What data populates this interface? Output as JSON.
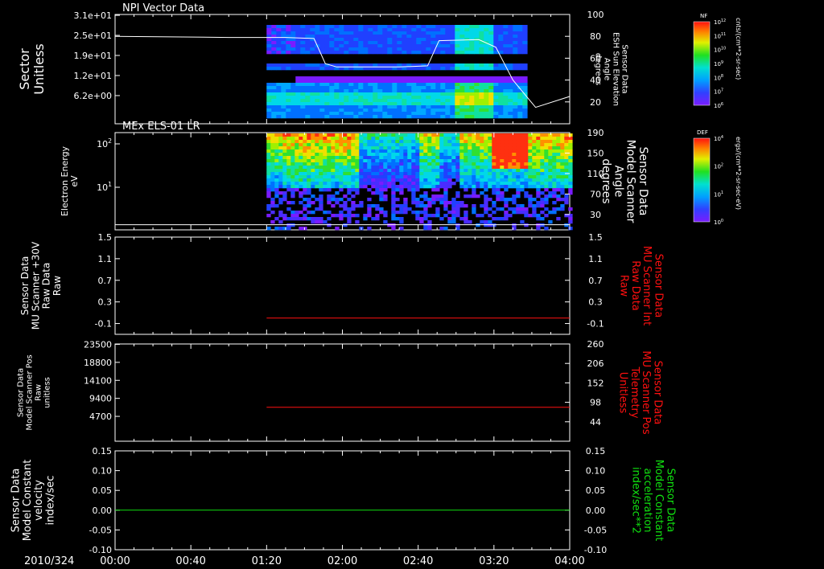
{
  "date_label": "2010/324",
  "time_ticks": [
    "00:00",
    "00:40",
    "01:20",
    "02:00",
    "02:40",
    "03:20",
    "04:00"
  ],
  "colors": {
    "white": "#ffffff",
    "red": "#ff1010",
    "green": "#10e010",
    "black": "#000000"
  },
  "colorbars": [
    {
      "id": "nf",
      "tag": "NF",
      "unit": "cnts/(cm**2-sr-sec)",
      "ticks": [
        "10^12",
        "10^11",
        "10^10",
        "10^9",
        "10^8",
        "10^7",
        "10^6"
      ]
    },
    {
      "id": "def",
      "tag": "DEF",
      "unit": "ergs/(cm**2-sr-sec-eV)",
      "ticks": [
        "10^4",
        "10^2",
        "10^1",
        "10^0"
      ]
    }
  ],
  "panels": [
    {
      "id": "p1",
      "title": "NPI Vector Data",
      "left_label": [
        "Sector",
        "Unitless"
      ],
      "left_color": "#ffffff",
      "left_ticks": [
        "3.1e+01",
        "2.5e+01",
        "1.9e+01",
        "1.2e+01",
        "6.2e+00"
      ],
      "right_label": [
        "Sensor Data",
        "ESH Sun Elevation",
        "Angle",
        "degrees"
      ],
      "right_color": "#ffffff",
      "right_ticks": [
        "100",
        "80",
        "60",
        "40",
        "20"
      ]
    },
    {
      "id": "p2",
      "title": "MEx ELS-01 LR",
      "left_label": [
        "Electron Energy",
        "eV"
      ],
      "left_color": "#ffffff",
      "left_ticks": [
        "10^2",
        "10^1"
      ],
      "right_label": [
        "Sensor Data",
        "Model Scanner",
        "Angle",
        "degrees"
      ],
      "right_color": "#ffffff",
      "right_ticks": [
        "190",
        "150",
        "110",
        "70",
        "30"
      ]
    },
    {
      "id": "p3",
      "title": "",
      "left_label": [
        "Sensor Data",
        "MU Scanner +30V",
        "Raw Data",
        "Raw"
      ],
      "left_color": "#ffffff",
      "left_ticks": [
        "1.5",
        "1.1",
        "0.7",
        "0.3",
        "-0.1"
      ],
      "right_label": [
        "Sensor Data",
        "MU Scanner Int",
        "Raw Data",
        "Raw"
      ],
      "right_color": "#ff1010",
      "right_ticks": [
        "1.5",
        "1.1",
        "0.7",
        "0.3",
        "-0.1"
      ]
    },
    {
      "id": "p4",
      "title": "",
      "left_label": [
        "Sensor Data",
        "Model Scanner Pos",
        "Raw",
        "unitless"
      ],
      "left_color": "#ffffff",
      "left_ticks": [
        "23500",
        "18800",
        "14100",
        "9400",
        "4700"
      ],
      "right_label": [
        "Sensor Data",
        "MU Scanner Pos",
        "Telemetry",
        "Unitless"
      ],
      "right_color": "#ff1010",
      "right_ticks": [
        "260",
        "206",
        "152",
        "98",
        "44"
      ]
    },
    {
      "id": "p5",
      "title": "",
      "left_label": [
        "Sensor Data",
        "Model Constant",
        "velocity",
        "index/sec"
      ],
      "left_color": "#ffffff",
      "left_ticks": [
        "0.15",
        "0.10",
        "0.05",
        "0.00",
        "-0.05",
        "-0.10"
      ],
      "right_label": [
        "Sensor Data",
        "Model Constant",
        "acceleration",
        "index/sec**2"
      ],
      "right_color": "#10e010",
      "right_ticks": [
        "0.15",
        "0.10",
        "0.05",
        "0.00",
        "-0.05",
        "-0.10"
      ]
    }
  ],
  "chart_data": [
    {
      "type": "heatmap",
      "panel": "p1",
      "title": "NPI Vector Data",
      "ylabel": "Sector Unitless",
      "ylim": [
        0,
        34
      ],
      "x_range": [
        "00:00",
        "04:00"
      ],
      "data_start": "01:20",
      "data_end": "03:35",
      "line": {
        "name": "ESH Sun Elevation Angle",
        "color": "#ffffff",
        "y_axis": "right",
        "ylim": [
          0,
          100
        ],
        "x_hours": [
          0,
          1.0,
          1.5,
          1.75,
          1.85,
          1.95,
          2.5,
          2.75,
          2.85,
          3.2,
          3.35,
          3.5,
          3.7,
          4.0
        ],
        "y": [
          80,
          79,
          79,
          78,
          55,
          52,
          52,
          53,
          76,
          77,
          70,
          40,
          15,
          25
        ]
      }
    },
    {
      "type": "heatmap",
      "panel": "p2",
      "title": "MEx ELS-01 LR",
      "ylabel": "Electron Energy eV",
      "yscale": "log",
      "ylim": [
        1,
        200
      ],
      "x_range": [
        "00:00",
        "04:00"
      ],
      "data_start": "01:20",
      "data_end": "04:00",
      "line": {
        "name": "Model Scanner Angle",
        "color": "#ffffff",
        "y_axis": "right",
        "ylim": [
          0,
          190
        ],
        "x_hours": [
          0,
          4.0
        ],
        "y": [
          10,
          10
        ]
      }
    },
    {
      "type": "line",
      "panel": "p3",
      "ylim": [
        -0.3,
        1.5
      ],
      "series": [
        {
          "name": "MU Scanner Int Raw Data",
          "color": "#ff1010",
          "x_hours": [
            1.333,
            4.0
          ],
          "y": [
            0.0,
            0.0
          ]
        }
      ]
    },
    {
      "type": "line",
      "panel": "p4",
      "ylim": [
        0,
        23500
      ],
      "series": [
        {
          "name": "MU Scanner Pos Telemetry",
          "color": "#ff1010",
          "x_hours": [
            1.333,
            4.0
          ],
          "y": [
            8200,
            8200
          ]
        }
      ]
    },
    {
      "type": "line",
      "panel": "p5",
      "ylim": [
        -0.1,
        0.15
      ],
      "series": [
        {
          "name": "Model Constant acceleration",
          "color": "#10e010",
          "x_hours": [
            0,
            4.0
          ],
          "y": [
            0.0,
            0.0
          ]
        }
      ]
    }
  ]
}
